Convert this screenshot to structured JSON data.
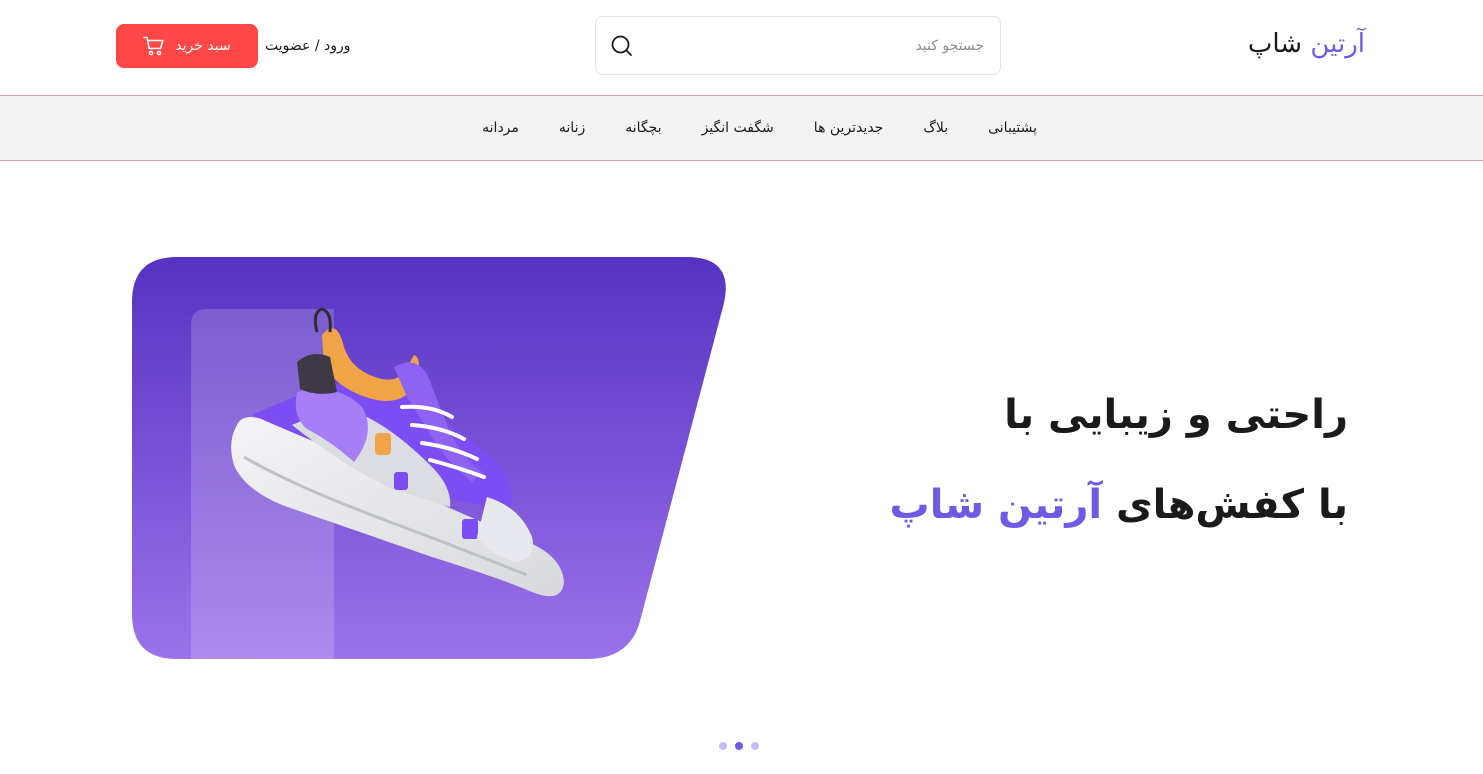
{
  "header": {
    "logo": {
      "accent": "آرتین",
      "rest": "شاپ"
    },
    "search": {
      "placeholder": "جستجو کنید",
      "value": ""
    },
    "auth": {
      "login": "ورود",
      "separator": "/",
      "register": "عضویت"
    },
    "cart": {
      "label": "سبد خرید",
      "icon": "cart-icon"
    }
  },
  "nav": {
    "items": [
      "مردانه",
      "زنانه",
      "بچگانه",
      "شگفت انگیز",
      "جدیدترین ها",
      "بلاگ",
      "پشتیبانی"
    ]
  },
  "hero": {
    "line1": "راحتی و زیبایی با",
    "line2_prefix": "با کفش‌های",
    "line2_accent": "آرتین شاپ",
    "image": "sneaker-image"
  },
  "slider": {
    "dots": 3,
    "active": 2
  },
  "colors": {
    "accent": "#6f5ae6",
    "cart": "#ff4747",
    "hero_top": "#5533c2",
    "hero_bottom": "#9b72ea",
    "nav_bg": "#f3f3f3",
    "nav_border": "#d7a3b4"
  }
}
